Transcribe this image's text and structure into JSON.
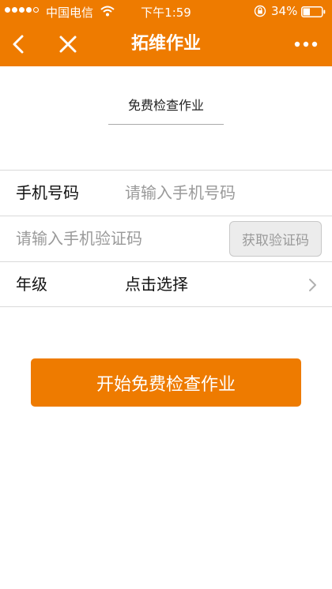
{
  "status_bar": {
    "carrier": "中国电信",
    "time": "下午1:59",
    "battery": "34%"
  },
  "nav": {
    "title": "拓维作业",
    "back_icon": "chevron-left-icon",
    "close_icon": "close-icon",
    "more_icon": "more-horizontal-icon"
  },
  "tab": {
    "label": "免费检查作业"
  },
  "form": {
    "phone_label": "手机号码",
    "phone_placeholder": "请输入手机号码",
    "phone_value": "",
    "code_placeholder": "请输入手机验证码",
    "code_value": "",
    "get_code_button": "获取验证码",
    "grade_label": "年级",
    "grade_value": "点击选择"
  },
  "actions": {
    "start_button": "开始免费检查作业"
  },
  "colors": {
    "accent": "#ee7b00"
  }
}
